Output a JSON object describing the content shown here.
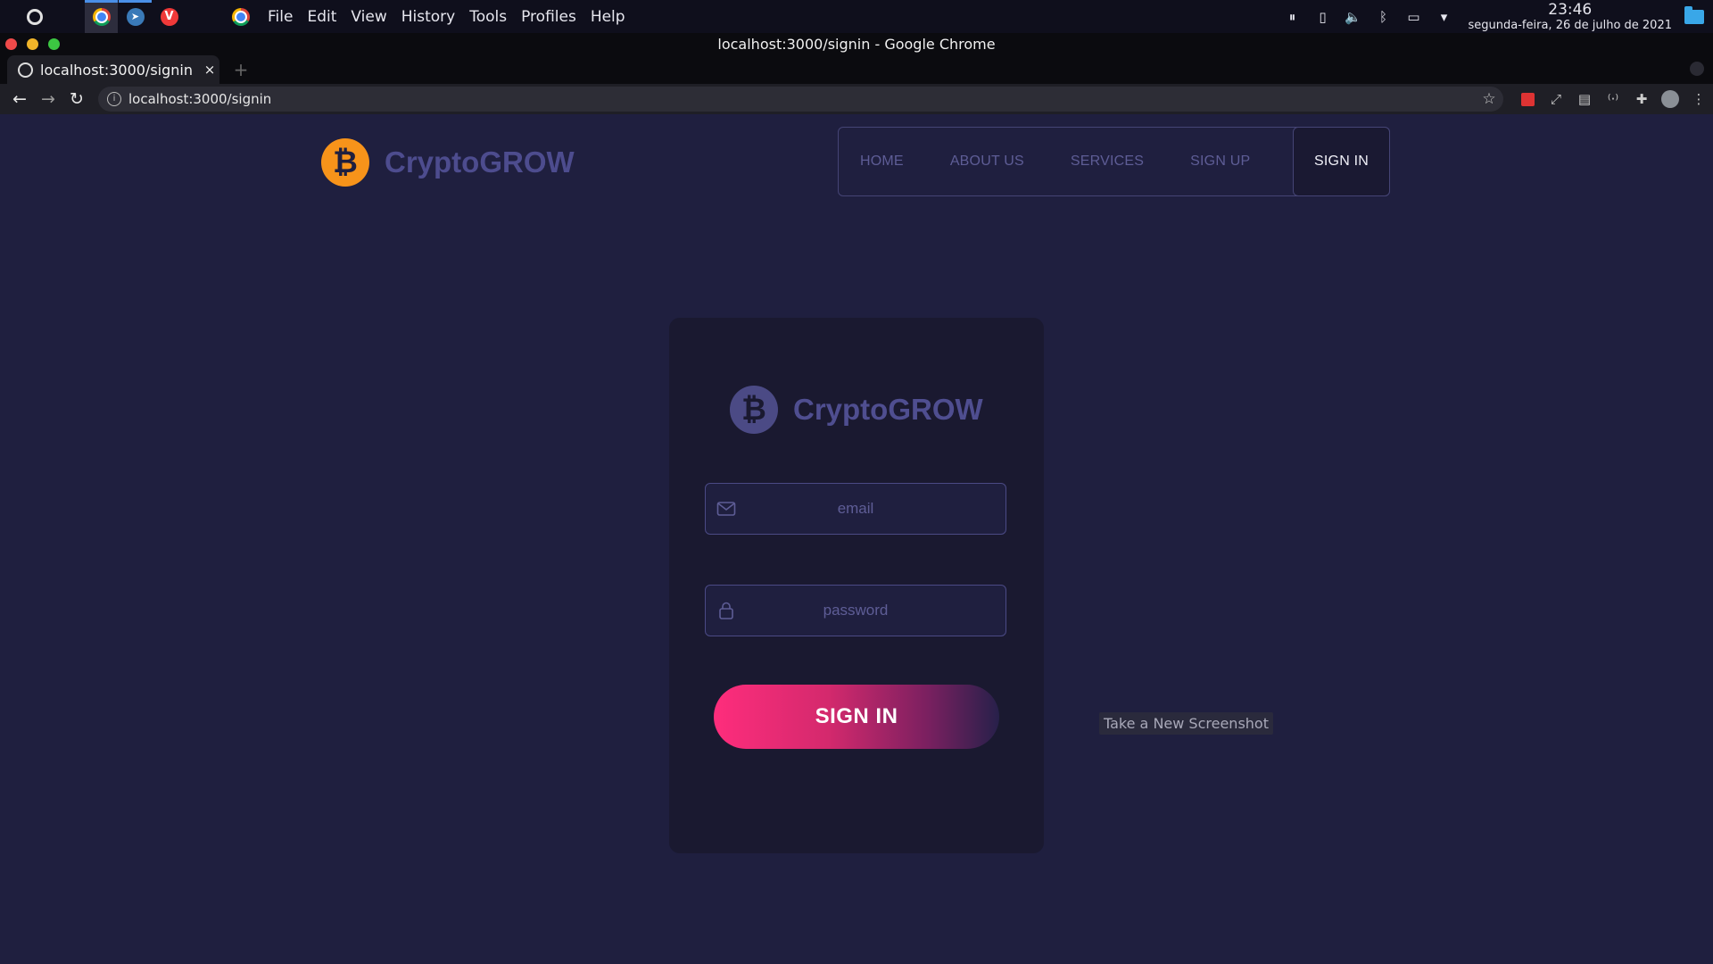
{
  "os": {
    "menu": [
      "File",
      "Edit",
      "View",
      "History",
      "Tools",
      "Profiles",
      "Help"
    ],
    "clock_time": "23:46",
    "clock_date": "segunda-feira, 26 de julho de 2021"
  },
  "browser": {
    "window_title": "localhost:3000/signin - Google Chrome",
    "tab_title": "localhost:3000/signin",
    "tab_close": "×",
    "new_tab": "+",
    "url": "localhost:3000/signin"
  },
  "site": {
    "brand": "CryptoGROW",
    "logo_symbol": "₿",
    "nav": [
      "HOME",
      "ABOUT US",
      "SERVICES",
      "SIGN UP",
      "SIGN IN"
    ],
    "active_nav": "SIGN IN"
  },
  "form": {
    "brand": "CryptoGROW",
    "logo_symbol": "₿",
    "email_placeholder": "email",
    "password_placeholder": "password",
    "submit_label": "SIGN IN"
  },
  "overlay": {
    "screenshot_tip": "Take a New Screenshot"
  },
  "colors": {
    "background": "#1f1f3f",
    "card": "#1a1930",
    "accent_orange": "#f7931a",
    "accent_pink": "#fe2d7c",
    "muted_text": "#5e5d96"
  }
}
